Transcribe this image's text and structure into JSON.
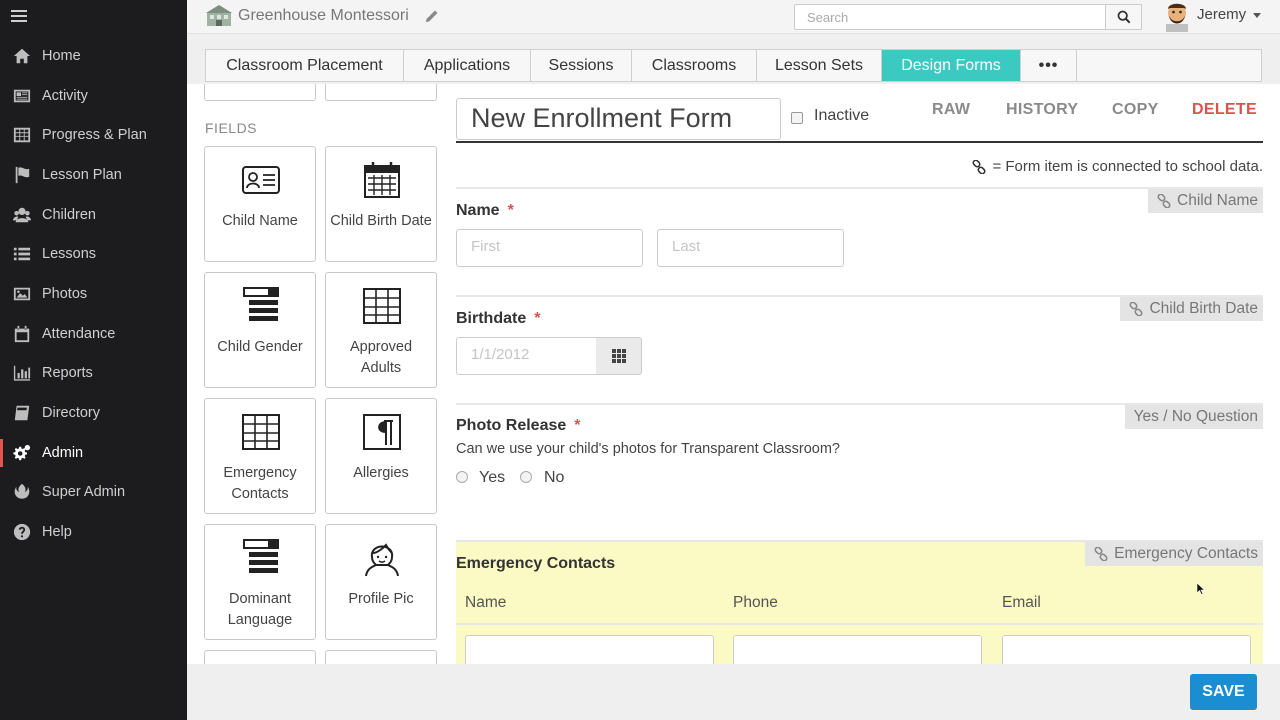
{
  "topbar": {
    "school_name": "Greenhouse Montessori",
    "search_placeholder": "Search",
    "user_name": "Jeremy"
  },
  "sidebar": {
    "items": [
      {
        "label": "Home",
        "icon": "home-icon"
      },
      {
        "label": "Activity",
        "icon": "activity-icon"
      },
      {
        "label": "Progress & Plan",
        "icon": "grid-icon"
      },
      {
        "label": "Lesson Plan",
        "icon": "flag-icon"
      },
      {
        "label": "Children",
        "icon": "children-icon"
      },
      {
        "label": "Lessons",
        "icon": "list-icon"
      },
      {
        "label": "Photos",
        "icon": "photo-icon"
      },
      {
        "label": "Attendance",
        "icon": "calendar-icon"
      },
      {
        "label": "Reports",
        "icon": "bar-chart-icon"
      },
      {
        "label": "Directory",
        "icon": "book-icon"
      },
      {
        "label": "Admin",
        "icon": "gears-icon"
      },
      {
        "label": "Super Admin",
        "icon": "rebel-icon"
      },
      {
        "label": "Help",
        "icon": "help-icon"
      }
    ],
    "active": "Admin"
  },
  "tabs": [
    {
      "label": "Classroom Placement"
    },
    {
      "label": "Applications"
    },
    {
      "label": "Sessions"
    },
    {
      "label": "Classrooms"
    },
    {
      "label": "Lesson Sets"
    },
    {
      "label": "Design Forms"
    },
    {
      "label": "•••"
    }
  ],
  "active_tab": "Design Forms",
  "fields_palette": {
    "heading": "FIELDS",
    "cards": [
      {
        "label": "Child Name",
        "icon": "id-card-icon"
      },
      {
        "label": "Child Birth Date",
        "icon": "calendar-icon"
      },
      {
        "label": "Child Gender",
        "icon": "select-list-icon"
      },
      {
        "label": "Approved Adults",
        "icon": "table-icon"
      },
      {
        "label": "Emergency Contacts",
        "icon": "table-icon"
      },
      {
        "label": "Allergies",
        "icon": "paragraph-icon"
      },
      {
        "label": "Dominant Language",
        "icon": "select-list-icon"
      },
      {
        "label": "Profile Pic",
        "icon": "person-icon"
      }
    ]
  },
  "form": {
    "title": "New Enrollment Form",
    "inactive_label": "Inactive",
    "inactive_checked": false,
    "actions": {
      "raw": "RAW",
      "history": "HISTORY",
      "copy": "COPY",
      "delete": "DELETE"
    },
    "legend": "= Form item is connected to school data.",
    "name": {
      "label": "Name",
      "required": "*",
      "tag": "Child Name",
      "first_placeholder": "First",
      "last_placeholder": "Last"
    },
    "birthdate": {
      "label": "Birthdate",
      "required": "*",
      "tag": "Child Birth Date",
      "placeholder": "1/1/2012"
    },
    "photo_release": {
      "label": "Photo Release",
      "required": "*",
      "tag": "Yes / No Question",
      "question": "Can we use your child's photos for Transparent Classroom?",
      "options": [
        "Yes",
        "No"
      ]
    },
    "emergency_contacts": {
      "label": "Emergency Contacts",
      "tag": "Emergency Contacts",
      "columns": [
        "Name",
        "Phone",
        "Email"
      ]
    }
  },
  "footer": {
    "save_label": "SAVE"
  },
  "colors": {
    "accent_tab": "#3cc9c2",
    "save": "#1a8ed1",
    "delete": "#d9534f",
    "required": "#d9534f",
    "highlight": "#fbf9c4",
    "sidebar": "#1c1c1e"
  }
}
